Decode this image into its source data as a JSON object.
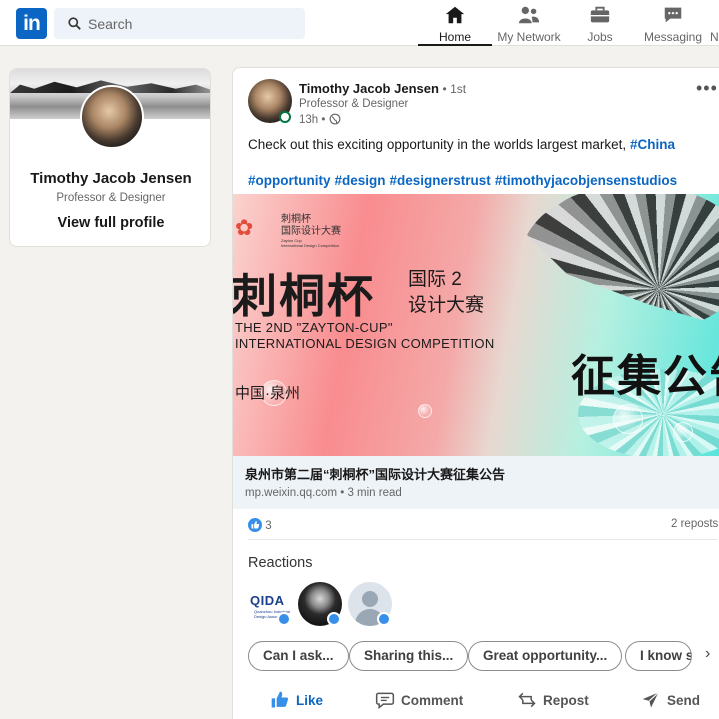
{
  "nav": {
    "search_placeholder": "Search",
    "items": [
      {
        "label": "Home",
        "icon": "home-icon",
        "active": true
      },
      {
        "label": "My Network",
        "icon": "network-icon"
      },
      {
        "label": "Jobs",
        "icon": "briefcase-icon"
      },
      {
        "label": "Messaging",
        "icon": "message-icon"
      },
      {
        "label": "N",
        "icon": "notification-icon"
      }
    ]
  },
  "profile": {
    "name": "Timothy Jacob Jensen",
    "title": "Professor & Designer",
    "link": "View full profile"
  },
  "post": {
    "author": "Timothy Jacob Jensen",
    "degree": "• 1st",
    "headline": "Professor & Designer",
    "time": "13h •",
    "more": "•••",
    "text": "Check out this exciting opportunity in the worlds largest market, ",
    "text_hashtag": "#China",
    "hashtags": [
      "#opportunity",
      "#design",
      "#designerstrust",
      "#timothyjacobjensenstudios"
    ],
    "banner": {
      "small_line1": "刺桐杯",
      "small_line2": "国际设计大赛",
      "small_line3": "Zayton Cup",
      "small_line4": "International Design Competition",
      "big_title": "刺桐杯",
      "side1": "国际 2",
      "side2": "设计大赛",
      "en1": "THE 2ND \"ZAYTON-CUP\"",
      "en2": "INTERNATIONAL DESIGN COMPETITION",
      "city": "中国·泉州",
      "right": "征集公告"
    },
    "link_title": "泉州市第二届“刺桐杯”国际设计大赛征集公告",
    "link_source": "mp.weixin.qq.com • 3 min read",
    "reaction_count": "3",
    "reposts": "2 reposts",
    "reactions_heading": "Reactions",
    "qida_text": "QIDA",
    "qida_sub": "Quanzhou Industrial Design Association",
    "chips": [
      "Can I ask...",
      "Sharing this...",
      "Great opportunity...",
      "I know s"
    ],
    "actions": {
      "like": "Like",
      "comment": "Comment",
      "repost": "Repost",
      "send": "Send"
    }
  },
  "colors": {
    "brand": "#0a66c2",
    "like": "#378fe9",
    "online": "#057642"
  }
}
